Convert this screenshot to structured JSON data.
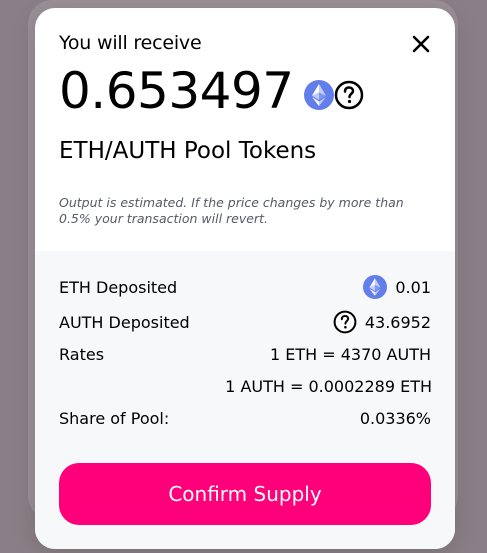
{
  "modal": {
    "title": "You will receive",
    "amount": "0.653497",
    "token_name": "ETH/AUTH Pool Tokens",
    "disclaimer": "Output is estimated. If the price changes by more than 0.5% your transaction will revert."
  },
  "details": {
    "eth_deposited_label": "ETH Deposited",
    "eth_deposited_value": "0.01",
    "auth_deposited_label": "AUTH Deposited",
    "auth_deposited_value": "43.6952",
    "rates_label": "Rates",
    "rate_1": "1 ETH = 4370 AUTH",
    "rate_2": "1 AUTH = 0.0002289 ETH",
    "share_label": "Share of Pool:",
    "share_value": "0.0336%"
  },
  "confirm_button_label": "Confirm Supply",
  "colors": {
    "accent": "#ff007a",
    "eth": "#627eea",
    "muted_text": "#565a69",
    "panel": "#f7f8fa"
  },
  "icons": {
    "close": "close-icon",
    "eth": "eth-icon",
    "unknown_token": "question-circle-icon"
  }
}
